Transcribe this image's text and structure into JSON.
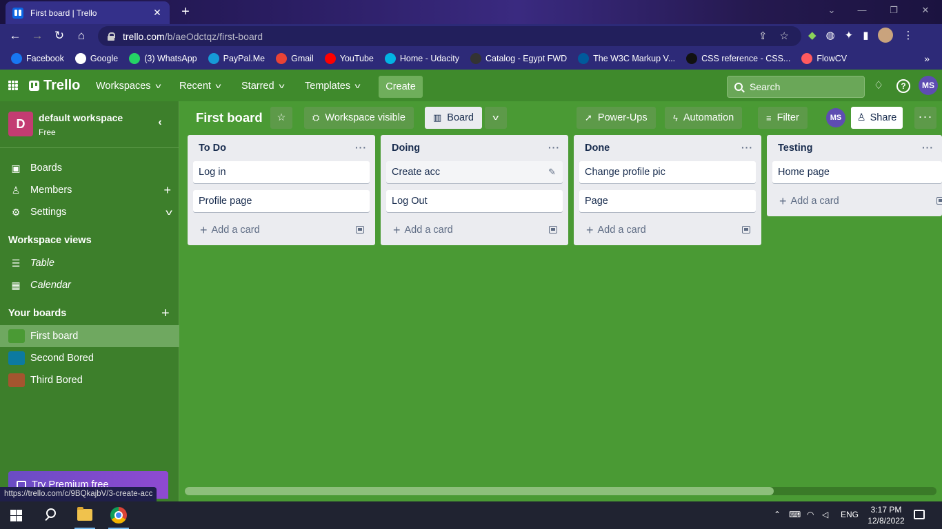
{
  "browser": {
    "tab_title": "First board | Trello",
    "tab_close": "✕",
    "new_tab": "+",
    "url_host": "trello.com",
    "url_path": "/b/aeOdctqz/first-board",
    "status_url": "https://trello.com/c/9BQkajbV/3-create-acc",
    "bookmarks": [
      {
        "label": "Facebook",
        "color": "#1877f2"
      },
      {
        "label": "Google",
        "color": "#ffffff"
      },
      {
        "label": "(3) WhatsApp",
        "color": "#25d366"
      },
      {
        "label": "PayPal.Me",
        "color": "#169bd7"
      },
      {
        "label": "Gmail",
        "color": "#ea4335"
      },
      {
        "label": "YouTube",
        "color": "#ff0000"
      },
      {
        "label": "Home - Udacity",
        "color": "#02b3e4"
      },
      {
        "label": "Catalog - Egypt FWD",
        "color": "#333333"
      },
      {
        "label": "The W3C Markup V...",
        "color": "#005a9c"
      },
      {
        "label": "CSS reference - CSS...",
        "color": "#111111"
      },
      {
        "label": "FlowCV",
        "color": "#ff5a5f"
      }
    ],
    "bookmarks_more": "»"
  },
  "header": {
    "logo": "Trello",
    "menus": [
      "Workspaces",
      "Recent",
      "Starred",
      "Templates"
    ],
    "create": "Create",
    "search_placeholder": "Search",
    "user_initials": "MS"
  },
  "sidebar": {
    "workspace_initial": "D",
    "workspace_name": "default workspace",
    "workspace_plan": "Free",
    "items": [
      {
        "label": "Boards",
        "icon": "trello-icon"
      },
      {
        "label": "Members",
        "icon": "person-icon"
      },
      {
        "label": "Settings",
        "icon": "gear-icon"
      }
    ],
    "views_heading": "Workspace views",
    "views": [
      {
        "label": "Table",
        "icon": "table-icon"
      },
      {
        "label": "Calendar",
        "icon": "calendar-icon"
      }
    ],
    "boards_heading": "Your boards",
    "boards": [
      {
        "label": "First board",
        "color": "#4a9a34",
        "active": true
      },
      {
        "label": "Second Bored",
        "color": "#0c7aa0",
        "active": false
      },
      {
        "label": "Third Bored",
        "color": "#a4552f",
        "active": false
      }
    ],
    "premium": "Try Premium free"
  },
  "board": {
    "title": "First board",
    "visibility": "Workspace visible",
    "view": "Board",
    "power_ups": "Power-Ups",
    "automation": "Automation",
    "filter": "Filter",
    "member_initials": "MS",
    "share": "Share"
  },
  "lists": [
    {
      "title": "To Do",
      "cards": [
        "Log in",
        "Profile page"
      ],
      "add": "Add a card"
    },
    {
      "title": "Doing",
      "cards": [
        "Create acc",
        "Log Out"
      ],
      "add": "Add a card"
    },
    {
      "title": "Done",
      "cards": [
        "Change profile pic",
        "Page"
      ],
      "add": "Add a card"
    },
    {
      "title": "Testing",
      "cards": [
        "Home page"
      ],
      "add": "Add a card"
    }
  ],
  "taskbar": {
    "lang": "ENG",
    "time": "3:17 PM",
    "date": "12/8/2022"
  },
  "colors": {
    "board_bg": "#4a9a34",
    "header_bg": "#3f8a2c",
    "sidebar_bg": "#3d7f2b",
    "list_bg": "#ebecf0"
  }
}
